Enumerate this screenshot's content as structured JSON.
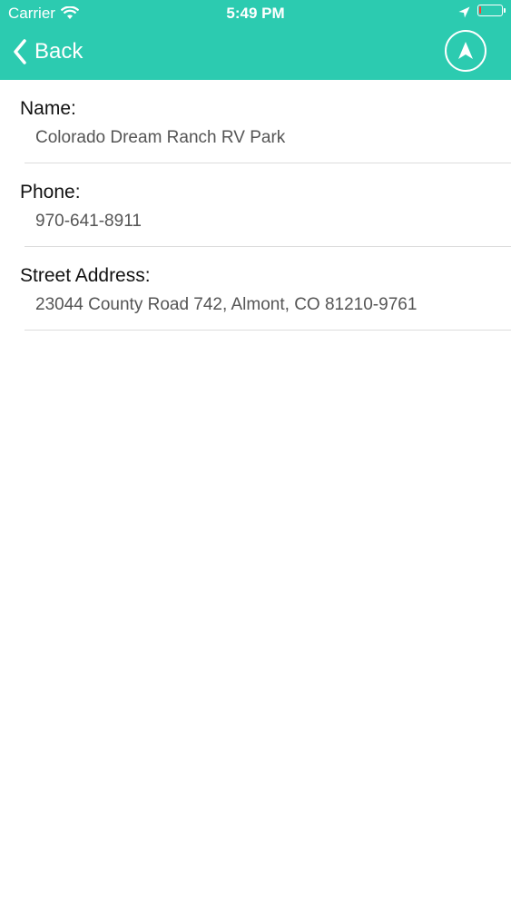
{
  "status_bar": {
    "carrier": "Carrier",
    "time": "5:49 PM",
    "wifi_icon": "wifi-icon",
    "location_icon": "location-arrow-icon",
    "battery_icon": "battery-low-icon",
    "battery_level_fraction": 0.1,
    "battery_level_color": "#ff3b30"
  },
  "nav_bar": {
    "back_label": "Back",
    "back_icon": "chevron-left-icon",
    "navigate_icon": "navigation-arrow-icon",
    "background_color": "#2ccbb0"
  },
  "details": [
    {
      "label": "Name:",
      "value": "Colorado Dream Ranch RV Park"
    },
    {
      "label": "Phone:",
      "value": "970-641-8911"
    },
    {
      "label": "Street Address:",
      "value": "23044 County Road 742, Almont, CO 81210-9761"
    }
  ]
}
